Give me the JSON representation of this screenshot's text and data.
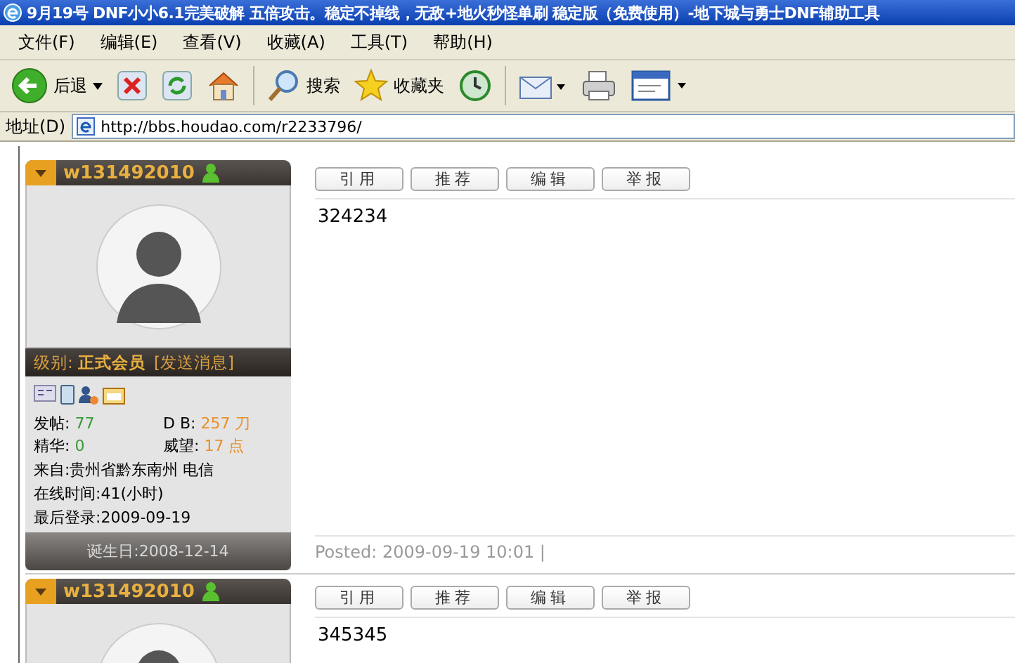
{
  "window": {
    "title": "9月19号 DNF小小6.1完美破解 五倍攻击。稳定不掉线，无敌+地火秒怪单刷 稳定版（免费使用）-地下城与勇士DNF辅助工具"
  },
  "menu": [
    "文件(F)",
    "编辑(E)",
    "查看(V)",
    "收藏(A)",
    "工具(T)",
    "帮助(H)"
  ],
  "toolbar": [
    {
      "kind": "back",
      "label": "后退"
    },
    {
      "kind": "stop"
    },
    {
      "kind": "refresh"
    },
    {
      "kind": "home"
    },
    {
      "kind": "search",
      "label": "搜索"
    },
    {
      "kind": "favorites",
      "label": "收藏夹"
    },
    {
      "kind": "history"
    },
    {
      "kind": "mail"
    },
    {
      "kind": "print"
    },
    {
      "kind": "edit"
    }
  ],
  "address_bar": {
    "label": "地址(D)",
    "url": "http://bbs.houdao.com/r2233796/"
  },
  "posts": [
    {
      "username": "w131492010",
      "level_label": "级别:",
      "level": "正式会员",
      "send_message": "[发送消息]",
      "stats": [
        {
          "label": "发帖:",
          "value": "77"
        },
        {
          "label": "D B:",
          "value": "257 刀"
        },
        {
          "label": "精华:",
          "value": "0"
        },
        {
          "label": "威望:",
          "value": "17 点"
        }
      ],
      "info": [
        "来自:贵州省黔东南州 电信",
        "在线时间:41(小时)",
        "最后登录:2009-09-19"
      ],
      "birthday": "诞生日:2008-12-14",
      "buttons": [
        "引用",
        "推荐",
        "编辑",
        "举报"
      ],
      "content": "324234",
      "posted": "Posted: 2009-09-19 10:01 |"
    },
    {
      "username": "w131492010",
      "buttons": [
        "引用",
        "推荐",
        "编辑",
        "举报"
      ],
      "content": "345345"
    }
  ]
}
